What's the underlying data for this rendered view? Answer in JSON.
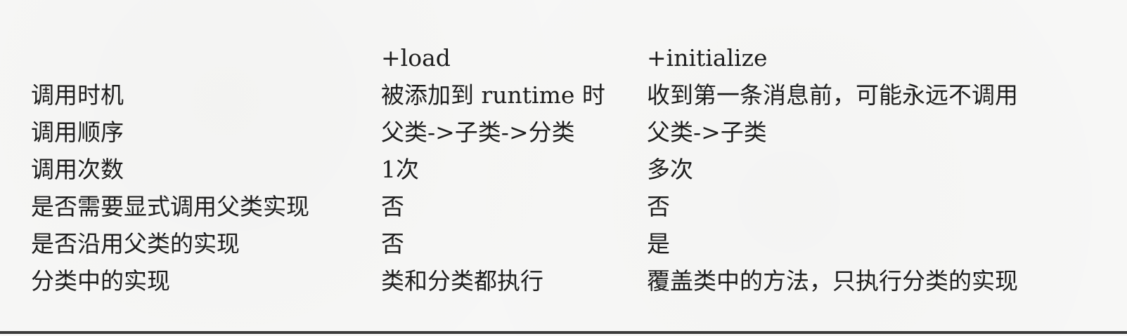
{
  "table": {
    "header": {
      "corner": "",
      "load": "+load",
      "initialize": "+initialize"
    },
    "rows": [
      {
        "label": "调用时机",
        "load": "被添加到 runtime 时",
        "initialize": "收到第一条消息前，可能永远不调用"
      },
      {
        "label": "调用顺序",
        "load": "父类->子类->分类",
        "initialize": "父类->子类"
      },
      {
        "label": "调用次数",
        "load": "1次",
        "initialize": "多次"
      },
      {
        "label": "是否需要显式调用父类实现",
        "load": "否",
        "initialize": "否"
      },
      {
        "label": "是否沿用父类的实现",
        "load": "否",
        "initialize": "是"
      },
      {
        "label": "分类中的实现",
        "load": "类和分类都执行",
        "initialize": "覆盖类中的方法，只执行分类的实现"
      }
    ]
  }
}
